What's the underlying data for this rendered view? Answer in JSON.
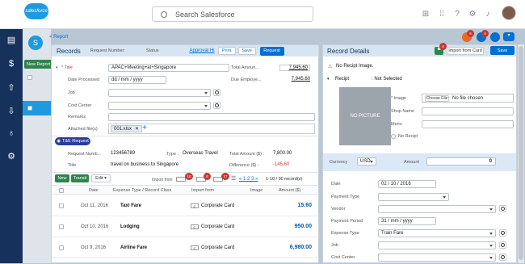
{
  "header": {
    "logo": "salesforce",
    "search_placeholder": "Search Salesforce"
  },
  "nav": {
    "icons": [
      "menu-icon",
      "home-icon",
      "dollar-icon",
      "upload-icon",
      "download-icon",
      "money-bag-icon",
      "settings-icon"
    ]
  },
  "app": {
    "back_link": "< Report",
    "new_report": "New Report"
  },
  "records": {
    "title": "Records",
    "request_number_label": "Request Number:",
    "status_label": "Status",
    "approval_link": "Approval Hi",
    "print": "Print",
    "save": "Save",
    "request": "Request",
    "title_label": "* Title",
    "title_value": "APAC+Meeting+at+Singapore",
    "total_amount_label": "Total Amoun...",
    "total_amount": "7,945.60",
    "date_processed_label": "Date Processed",
    "date_processed": "dd / mm / yyyy",
    "due_employee_label": "Due Employe...",
    "due_employee": "7,945.60",
    "job_label": "Job",
    "cost_center_label": "Cost Center",
    "remarks_label": "Remarks",
    "attached_label": "Attached file(s)",
    "attached_file": "001.xlsx",
    "te_request": "T&E Request",
    "req_num_label": "Request Numb...",
    "req_num": "123456789",
    "type_label": "Type :",
    "type_value": "Overseas Travel",
    "total_amount_s_label": "Total Amount ($) :",
    "total_amount_s": "7,800.00",
    "title2_label": "Title",
    "title2": "travel on business to Singapore",
    "difference_label": "Difference ($) :",
    "difference": "-145.60",
    "toolbar": {
      "new": "New",
      "transit": "Transit",
      "edit": "Edit",
      "import_from": "Import from",
      "badge1": "10",
      "badge2": "6",
      "badge3": "17",
      "pagination": "1 2 3",
      "range": "1-10 / 30 record(s)"
    },
    "columns": [
      "Date",
      "Expense Type / Record Class",
      "Import from",
      "Image",
      "Amount ($)"
    ],
    "rows": [
      {
        "date": "Oct 11, 2016",
        "type": "Taxi Fare",
        "import": "Corporate Card",
        "amount": "15.60"
      },
      {
        "date": "Oct 10, 2016",
        "type": "Lodging",
        "import": "Corporate Card",
        "amount": "950.00"
      },
      {
        "date": "Oct 9, 2016",
        "type": "Airline Fare",
        "import": "Corporate Card",
        "amount": "6,980.00"
      }
    ]
  },
  "details": {
    "title": "Record Details",
    "import_card": "Import from Card",
    "save": "Save",
    "badge": "4",
    "no_receipt": "No Recipt Image.",
    "receipt_label": "Recipt",
    "receipt_value": ": Not Selected",
    "image_label": "* Image",
    "choose_file": "Choose File",
    "no_file": "No file chosen",
    "shop_label": "Shop Name",
    "menu_label": "Menu",
    "no_receipt_check": "No Recipt",
    "no_picture": "NO PICTURE",
    "currency_label": "Currency",
    "currency": "USD",
    "amount_label": "Amount",
    "amount": "0",
    "date_label": "Date",
    "date_value": "02 / 10 / 2016",
    "payment_type_label": "Payment Type",
    "vendor_label": "Vendor",
    "payment_period_label": "Payment Period",
    "payment_period": "31 / mm / yyyy",
    "expense_type_label": "Expense Type",
    "expense_type": "Train Fare",
    "job_label": "Job",
    "cost_center_label": "Cost Center"
  },
  "colors": {
    "nav": "#16325c",
    "accent": "#0070d2",
    "panel_header": "#d6e5f2",
    "green": "#2e844a",
    "badge": "#c23934"
  }
}
